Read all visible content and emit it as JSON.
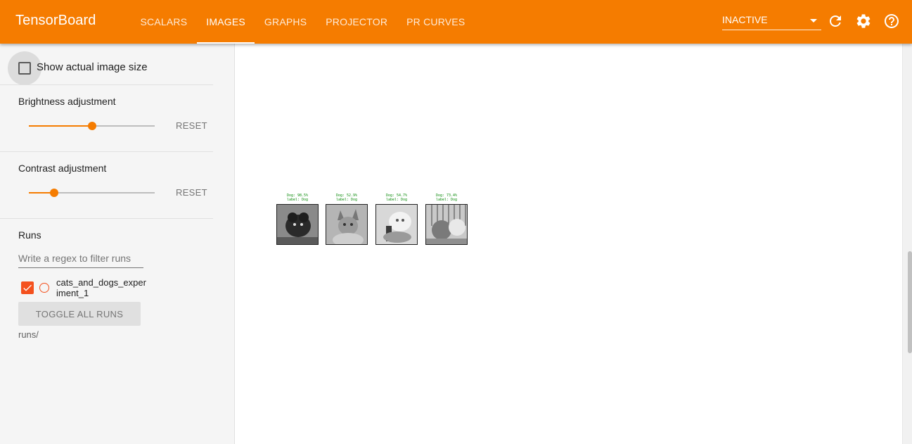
{
  "app": {
    "title": "TensorBoard"
  },
  "colors": {
    "brand": "#f57c00",
    "run_color": "#f4511e"
  },
  "nav": {
    "tabs": [
      {
        "label": "SCALARS",
        "active": false
      },
      {
        "label": "IMAGES",
        "active": true
      },
      {
        "label": "GRAPHS",
        "active": false
      },
      {
        "label": "PROJECTOR",
        "active": false
      },
      {
        "label": "PR CURVES",
        "active": false
      }
    ]
  },
  "toolbar": {
    "reload_state": "INACTIVE",
    "refresh_icon": "refresh-icon",
    "settings_icon": "gear-icon",
    "help_icon": "help-icon"
  },
  "sidebar": {
    "actual_size_label": "Show actual image size",
    "actual_size_checked": false,
    "brightness": {
      "label": "Brightness adjustment",
      "value_fraction": 0.5,
      "reset_label": "RESET"
    },
    "contrast": {
      "label": "Contrast adjustment",
      "value_fraction": 0.2,
      "reset_label": "RESET"
    },
    "runs": {
      "title": "Runs",
      "filter_placeholder": "Write a regex to filter runs",
      "items": [
        {
          "name": "cats_and_dogs_experiment_1",
          "checked": true
        }
      ],
      "toggle_all_label": "TOGGLE ALL RUNS",
      "directory": "runs/"
    }
  },
  "images": [
    {
      "caption_line1": "Dog: 98.5%",
      "caption_line2": "label: Dog"
    },
    {
      "caption_line1": "Dog: 52.9%",
      "caption_line2": "label: Dog"
    },
    {
      "caption_line1": "Dog: 54.7%",
      "caption_line2": "label: Dog"
    },
    {
      "caption_line1": "Dog: 73.4%",
      "caption_line2": "label: Dog"
    }
  ]
}
